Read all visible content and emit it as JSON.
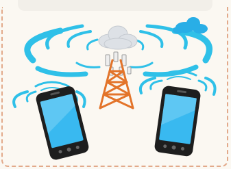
{
  "illustration": {
    "subject": "cell-tower-with-cloud-and-two-smartphones",
    "colors": {
      "signal_arcs": "#2fc0e8",
      "tower": "#e3742a",
      "phone_body": "#1e1e1e",
      "phone_screen": "#39b9f0",
      "cloud": "#d9dde3",
      "cloud_small": "#29aee6",
      "border_dash": "#e2a98a",
      "background": "#fbf8f2"
    }
  }
}
